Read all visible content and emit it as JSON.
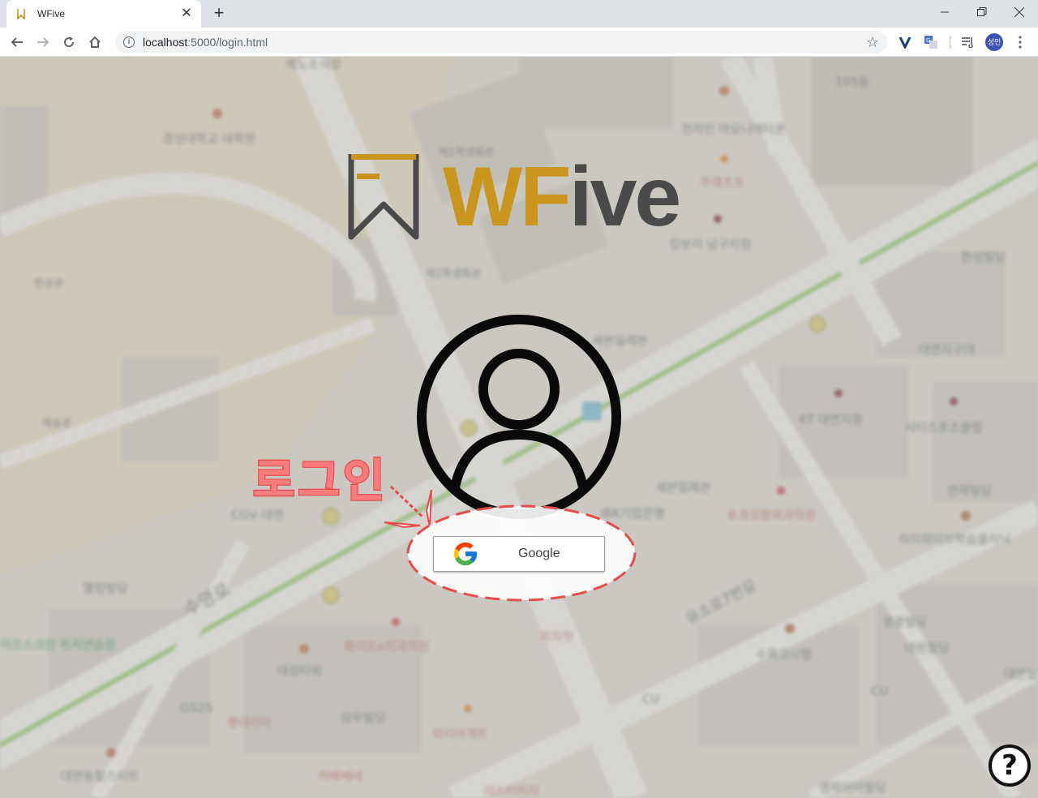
{
  "browser": {
    "tab_title": "WFive",
    "url_host": "localhost",
    "url_rest": ":5000/login.html",
    "profile_initials": "성민"
  },
  "page": {
    "logo_text_w": "WF",
    "logo_text_rest": "ive",
    "annotation_text": "로그인",
    "google_button_label": "Google",
    "help_label": "?"
  },
  "map": {
    "labels": [
      "예노소극장",
      "105동",
      "경성대학교 대학원",
      "천자인 마요니에타운",
      "제1학생회관",
      "푸레츠프",
      "킹보리 남구지점",
      "한성빌딩",
      "제2학생회관",
      "한성관",
      "세븐일레븐",
      "대연지구대",
      "예술관",
      "KT 대연지점",
      "시티스포츠클럽",
      "로그인",
      "수영로",
      "세븐일레븐",
      "CGV 대연",
      "IBK기업은행",
      "B.B성형외과의원",
      "연제빌딩",
      "하이파이브학습클리닉",
      "엘림빌딩",
      "유소로7번길",
      "영광빌딩",
      "대원빌딩",
      "화이트e치과의원",
      "피자헛",
      "대성타워",
      "수목고시텔",
      "GS25",
      "롯데리아",
      "삼우빌딩",
      "파리바게트",
      "CU",
      "CU",
      "대연동힐스티트",
      "카페베네",
      "미스터피자",
      "엠파이어빌딩",
      "대연빌딩",
      "이프스크린 위치연습장"
    ]
  },
  "colors": {
    "logo_gold": "#c9951c",
    "logo_dark": "#4a4a4a",
    "annotation_red": "#e84b4b"
  }
}
